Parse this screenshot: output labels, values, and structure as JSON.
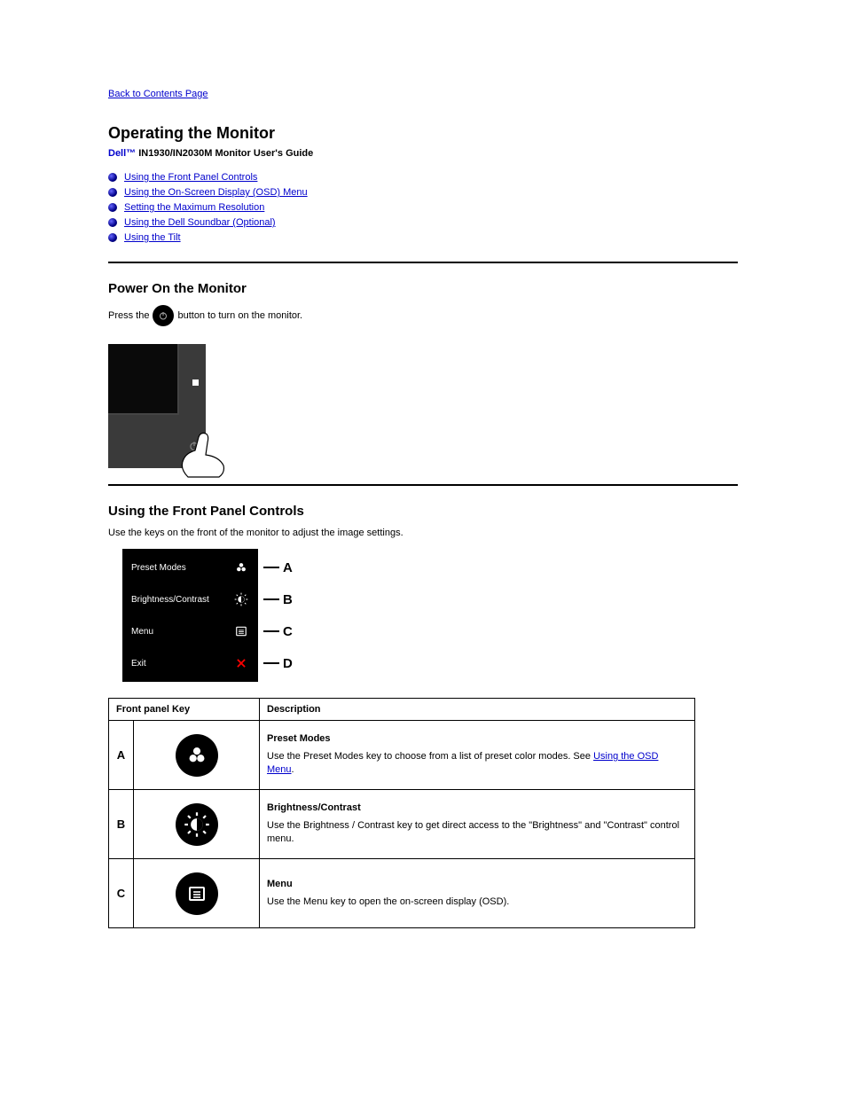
{
  "nav": {
    "back": "Back to Contents Page"
  },
  "heading": "Operating the Monitor",
  "subheading_prefix": "Dell™",
  "subheading_rest": " IN1930/IN2030M Monitor User's Guide",
  "toc": [
    "Using the Front Panel Controls",
    "Using the On-Screen Display (OSD) Menu",
    "Setting the Maximum Resolution",
    "Using the Dell Soundbar (Optional)",
    "Using the Tilt"
  ],
  "section1": {
    "title": "Power On the Monitor",
    "text_before": "Press the ",
    "text_after": " button to turn on the monitor."
  },
  "section2": {
    "title": "Using the Front Panel Controls",
    "intro": "Use the keys on the front of the monitor to adjust the image settings.",
    "osd_labels": [
      "Preset Modes",
      "Brightness/Contrast",
      "Menu",
      "Exit"
    ],
    "callouts": [
      "A",
      "B",
      "C",
      "D"
    ],
    "table": {
      "head_left": "Front panel Key",
      "head_right": "Description",
      "rows": [
        {
          "letter": "A",
          "icon": "preset-modes-icon",
          "title": "Preset Modes",
          "body_before": "Use the Preset Modes key to choose from a list of preset color modes. See ",
          "link": "Using the OSD Menu",
          "body_after": "."
        },
        {
          "letter": "B",
          "icon": "brightness-contrast-icon",
          "title": "Brightness/Contrast",
          "body": "Use the Brightness / Contrast key to get direct access to the \"Brightness\" and \"Contrast\" control menu."
        },
        {
          "letter": "C",
          "icon": "menu-icon",
          "title": "Menu",
          "body": "Use the Menu key to open the on-screen display (OSD)."
        }
      ]
    }
  }
}
